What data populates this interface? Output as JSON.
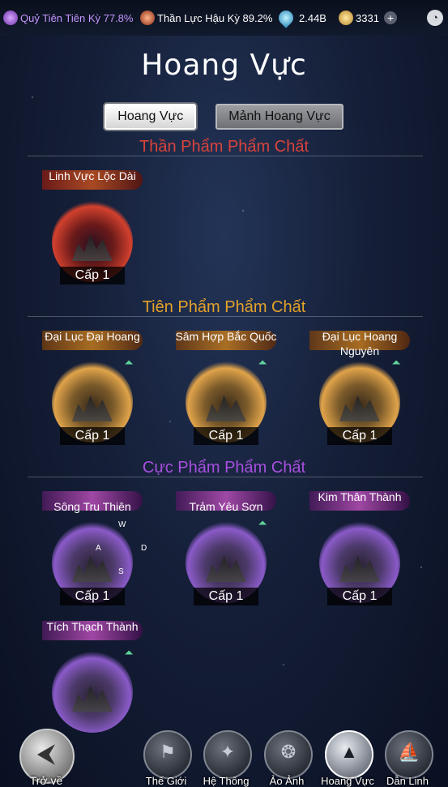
{
  "status": {
    "res1_label": "Quỷ Tiên Tiên Kỳ 77.8%",
    "res2_label": "Thần Lực Hậu Kỳ 89.2%",
    "res3_label": "2.44B",
    "res4_label": "3331",
    "plus": "+",
    "clock": "◔"
  },
  "page_title": "Hoang Vực",
  "tabs": {
    "active": "Hoang Vực",
    "inactive": "Mảnh Hoang Vực"
  },
  "sections": {
    "than": "Thần Phẩm Phẩm Chất",
    "tien": "Tiên Phẩm Phẩm Chất",
    "cuc": "Cực Phẩm Phẩm Chất"
  },
  "items": {
    "linh_vuc": {
      "name": "Linh Vực Lộc Dài",
      "level": "Cấp 1"
    },
    "dai_luc_dai_hoang": {
      "name": "Đại Lục Đại Hoang",
      "level": "Cấp 1"
    },
    "sam_hop": {
      "name": "Sâm Hợp Bắc Quốc",
      "level": "Cấp 1"
    },
    "dai_luc_hoang": {
      "name": "Đại Lục Hoang Nguyên",
      "level": "Cấp 1"
    },
    "song_tru": {
      "name": "Sông Tru Thiên",
      "level": "Cấp 1"
    },
    "tram_yeu": {
      "name": "Trảm Yêu Sơn",
      "level": "Cấp 1"
    },
    "kim_than": {
      "name": "Kim Thân Thành",
      "level": "Cấp 1"
    },
    "tich_thach": {
      "name": "Tích Thạch Thành"
    }
  },
  "wasd": {
    "w": "W",
    "a": "A",
    "s": "S",
    "d": "D"
  },
  "nav": {
    "back": "Trở về",
    "the_gioi": "Thế Giới",
    "he_thong": "Hệ Thống",
    "ao_anh": "Ảo Ảnh",
    "hoang_vuc": "Hoang Vực",
    "dan_linh": "Dẫn Linh"
  },
  "colors": {
    "than": "#d9433c",
    "tien": "#e3a12a",
    "cuc": "#a84fe0"
  }
}
